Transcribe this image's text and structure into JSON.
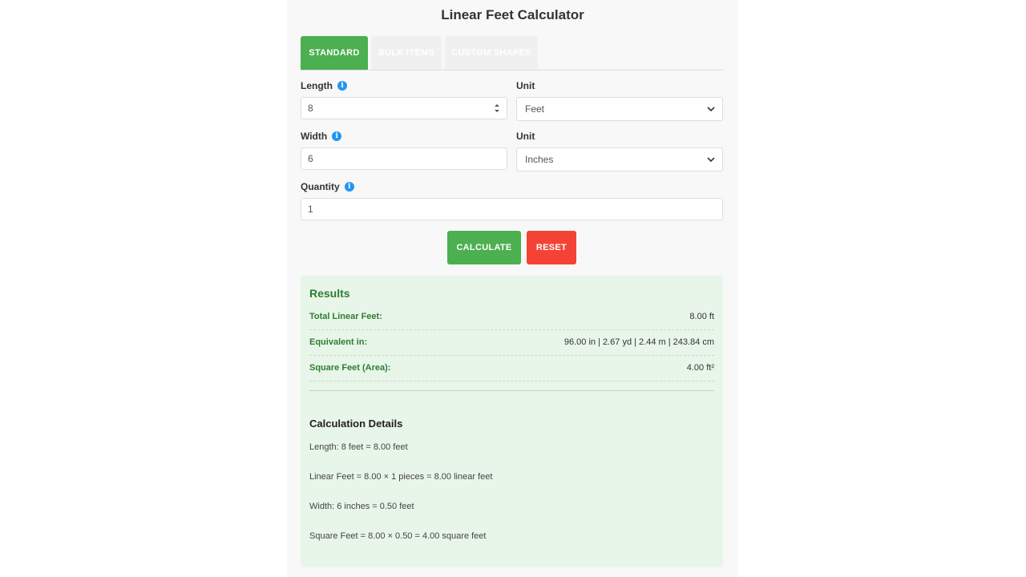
{
  "header": {
    "title": "Linear Feet Calculator"
  },
  "tabs": [
    {
      "label": "STANDARD",
      "active": true
    },
    {
      "label": "BULK ITEMS",
      "active": false
    },
    {
      "label": "CUSTOM SHAPES",
      "active": false
    }
  ],
  "form": {
    "length": {
      "label": "Length",
      "value": "8",
      "icon": "info-icon"
    },
    "length_unit": {
      "label": "Unit",
      "selected": "Feet"
    },
    "width": {
      "label": "Width",
      "value": "6",
      "icon": "info-icon"
    },
    "width_unit": {
      "label": "Unit",
      "selected": "Inches"
    },
    "quantity": {
      "label": "Quantity",
      "value": "1",
      "icon": "info-icon"
    },
    "info_glyph": "i"
  },
  "buttons": {
    "calculate_label": "CALCULATE",
    "reset_label": "RESET"
  },
  "results": {
    "heading": "Results",
    "rows": [
      {
        "label": "Total Linear Feet:",
        "value": "8.00 ft"
      },
      {
        "label": "Equivalent in:",
        "value": "96.00 in | 2.67 yd | 2.44 m | 243.84 cm"
      },
      {
        "label": "Square Feet (Area):",
        "value": "4.00 ft²"
      }
    ]
  },
  "details": {
    "heading": "Calculation Details",
    "lines": [
      "Length: 8 feet = 8.00 feet",
      "Linear Feet = 8.00 × 1 pieces = 8.00 linear feet",
      "Width: 6 inches = 0.50 feet",
      "Square Feet = 8.00 × 0.50 = 4.00 square feet"
    ]
  },
  "colors": {
    "primary": "#4caf50",
    "danger": "#f44336",
    "info": "#2196f3",
    "results_bg": "#e8f5e9",
    "results_text": "#2e7d32"
  }
}
